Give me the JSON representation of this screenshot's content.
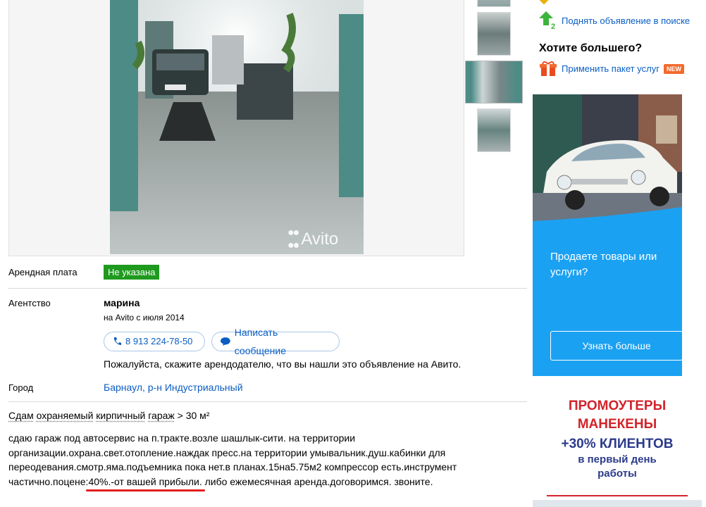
{
  "photos": {
    "watermark": "Avito",
    "thumbnail_count": 4
  },
  "right_actions": {
    "raise_label": "Поднять объявление в поиске",
    "want_more_heading": "Хотите большего?",
    "package_label": "Применить пакет услуг",
    "new_badge": "NEW"
  },
  "ad_blue": {
    "text": "Продаете товары или услуги?",
    "button": "Узнать больше"
  },
  "ad_promo": {
    "line1": "ПРОМОУТЕРЫ",
    "line2": "МАНЕКЕНЫ",
    "line3": "+30% КЛИЕНТОВ",
    "line4": "в первый день",
    "line5": "работы"
  },
  "details": {
    "rent_label": "Арендная плата",
    "rent_value": "Не указана",
    "agency_label": "Агентство",
    "seller_name": "марина",
    "seller_since": "на Avito с июля 2014",
    "phone": "8 913 224-78-50",
    "message_button": "Написать сообщение",
    "note": "Пожалуйста, скажите арендодателю, что вы нашли это объявление на Авито.",
    "city_label": "Город",
    "city_value": "Барнаул, р-н Индустриальный"
  },
  "listing": {
    "w1": "Сдам",
    "w2": "охраняемый",
    "w3": "кирпичный",
    "w4": "гараж",
    "size": "> 30 м²",
    "description_1": "сдаю гараж под автосервис на п.тракте.возле шашлык-сити. на территории",
    "description_2": "организации.охрана.свет.отопление.наждак пресс.на территории умывальник.душ.кабинки для",
    "description_3": "переодевания.смотр.яма.подъемника пока нет.в планах.15на5.75м2 компрессор есть.инструмент",
    "description_4a": "частично.поцене:",
    "description_4b": "40%.-от вашей прибыли.",
    "description_4c": " либо ежемесячная аренда.договоримся. звоните."
  },
  "colors": {
    "link": "#0a5ec2",
    "badge_green": "#1e9a1e",
    "ad_blue": "#1ba1f2",
    "promo_red": "#d2232a",
    "promo_navy": "#2b3a8c"
  }
}
